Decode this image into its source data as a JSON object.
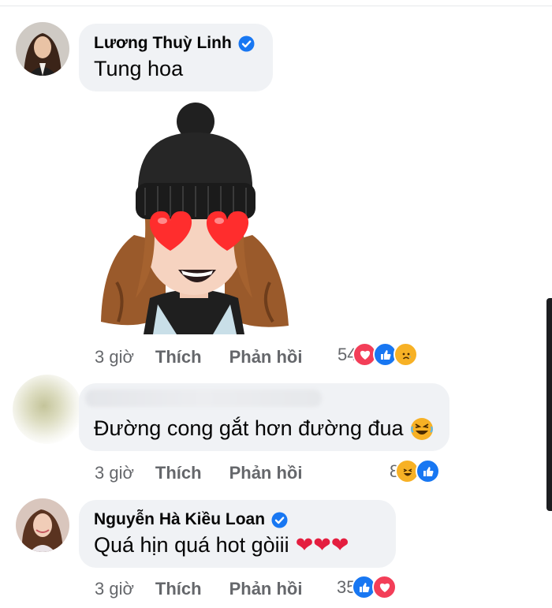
{
  "comments": [
    {
      "author": "Lương Thuỳ Linh",
      "verified": true,
      "text": "Tung hoa",
      "time": "3 giờ",
      "like_label": "Thích",
      "reply_label": "Phản hồi",
      "reaction_count": "54",
      "reactions": [
        "love-reaction-icon",
        "like-reaction-icon",
        "sad-reaction-icon"
      ],
      "sticker": "avatar-sticker-heart-eyes-beanie"
    },
    {
      "author": "",
      "verified": false,
      "text": "Đường cong gắt hơn đường đua",
      "text_emoji": "rolling-laughing-emoji",
      "time": "3 giờ",
      "like_label": "Thích",
      "reply_label": "Phản hồi",
      "reaction_count": "8",
      "reactions": [
        "haha-reaction-icon",
        "like-reaction-icon"
      ]
    },
    {
      "author": "Nguyễn Hà Kiều Loan",
      "verified": true,
      "text": "Quá hịn quá hot gòiii",
      "text_emoji": "three-red-hearts",
      "hearts": "❤❤❤",
      "time": "3 giờ",
      "like_label": "Thích",
      "reply_label": "Phản hồi",
      "reaction_count": "35",
      "reactions": [
        "like-reaction-icon",
        "love-reaction-icon"
      ]
    }
  ],
  "colors": {
    "bubble": "#f0f2f5",
    "meta_text": "#65676b",
    "verified_blue": "#1877f2",
    "love_red": "#f33e58",
    "haha_yellow": "#f7b125"
  }
}
